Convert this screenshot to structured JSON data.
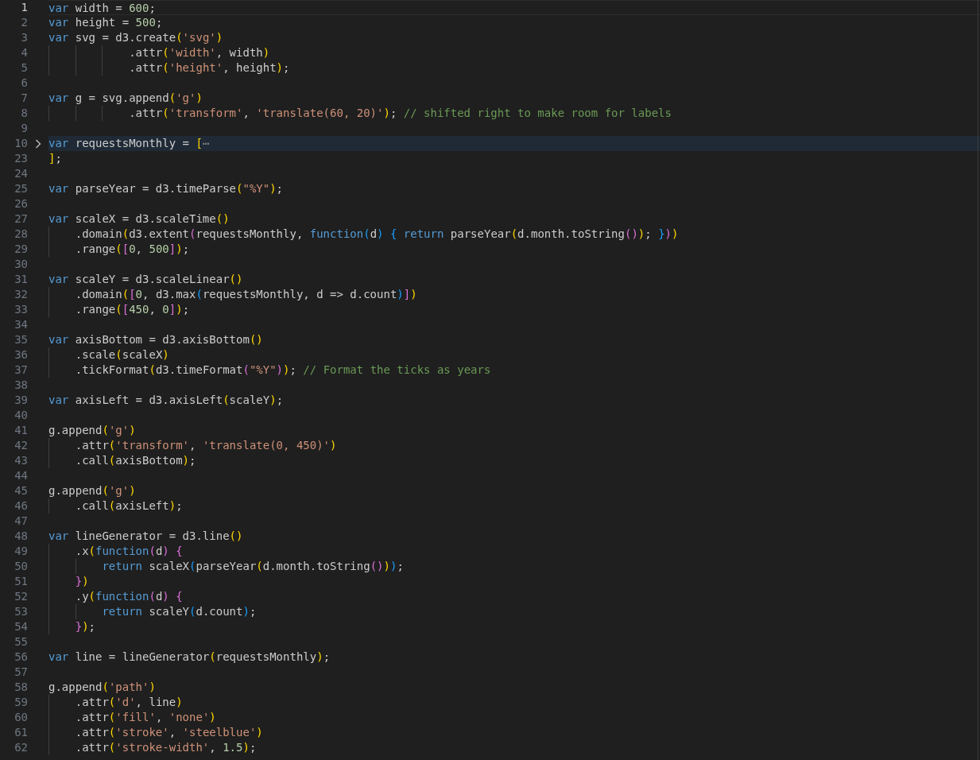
{
  "editor": {
    "lines": [
      {
        "number": "1",
        "active": true,
        "folded": false,
        "highlighted": false,
        "tokens": [
          {
            "kind": "k",
            "text": "var"
          },
          {
            "kind": "t",
            "text": " width = "
          },
          {
            "kind": "n",
            "text": "600"
          },
          {
            "kind": "t",
            "text": ";"
          }
        ]
      },
      {
        "number": "2",
        "active": false,
        "folded": false,
        "highlighted": false,
        "tokens": [
          {
            "kind": "k",
            "text": "var"
          },
          {
            "kind": "t",
            "text": " height = "
          },
          {
            "kind": "n",
            "text": "500"
          },
          {
            "kind": "t",
            "text": ";"
          }
        ]
      },
      {
        "number": "3",
        "active": false,
        "folded": false,
        "highlighted": false,
        "tokens": [
          {
            "kind": "k",
            "text": "var"
          },
          {
            "kind": "t",
            "text": " svg = d3.create"
          },
          {
            "kind": "b1",
            "text": "("
          },
          {
            "kind": "s",
            "text": "'svg'"
          },
          {
            "kind": "b1",
            "text": ")"
          }
        ]
      },
      {
        "number": "4",
        "active": false,
        "folded": false,
        "highlighted": false,
        "tokens": [
          {
            "kind": "t",
            "text": "            .attr"
          },
          {
            "kind": "b1",
            "text": "("
          },
          {
            "kind": "s",
            "text": "'width'"
          },
          {
            "kind": "t",
            "text": ", width"
          },
          {
            "kind": "b1",
            "text": ")"
          }
        ]
      },
      {
        "number": "5",
        "active": false,
        "folded": false,
        "highlighted": false,
        "tokens": [
          {
            "kind": "t",
            "text": "            .attr"
          },
          {
            "kind": "b1",
            "text": "("
          },
          {
            "kind": "s",
            "text": "'height'"
          },
          {
            "kind": "t",
            "text": ", height"
          },
          {
            "kind": "b1",
            "text": ")"
          },
          {
            "kind": "t",
            "text": ";"
          }
        ]
      },
      {
        "number": "6",
        "active": false,
        "folded": false,
        "highlighted": false
      },
      {
        "number": "7",
        "active": false,
        "folded": false,
        "highlighted": false,
        "tokens": [
          {
            "kind": "k",
            "text": "var"
          },
          {
            "kind": "t",
            "text": " g = svg.append"
          },
          {
            "kind": "b1",
            "text": "("
          },
          {
            "kind": "s",
            "text": "'g'"
          },
          {
            "kind": "b1",
            "text": ")"
          }
        ]
      },
      {
        "number": "8",
        "active": false,
        "folded": false,
        "highlighted": false,
        "tokens": [
          {
            "kind": "t",
            "text": "            .attr"
          },
          {
            "kind": "b1",
            "text": "("
          },
          {
            "kind": "s",
            "text": "'transform'"
          },
          {
            "kind": "t",
            "text": ", "
          },
          {
            "kind": "s",
            "text": "'translate(60, 20)'"
          },
          {
            "kind": "b1",
            "text": ")"
          },
          {
            "kind": "t",
            "text": "; "
          },
          {
            "kind": "c",
            "text": "// shifted right to make room for labels"
          }
        ]
      },
      {
        "number": "9",
        "active": false,
        "folded": false,
        "highlighted": false
      },
      {
        "number": "10",
        "active": false,
        "folded": true,
        "highlighted": true,
        "tokens": [
          {
            "kind": "k",
            "text": "var"
          },
          {
            "kind": "t",
            "text": " requestsMonthly = "
          },
          {
            "kind": "b1",
            "text": "["
          },
          {
            "kind": "e",
            "text": "⋯"
          }
        ]
      },
      {
        "number": "23",
        "active": false,
        "folded": false,
        "highlighted": false,
        "tokens": [
          {
            "kind": "b1",
            "text": "]"
          },
          {
            "kind": "t",
            "text": ";"
          }
        ]
      },
      {
        "number": "24",
        "active": false,
        "folded": false,
        "highlighted": false
      },
      {
        "number": "25",
        "active": false,
        "folded": false,
        "highlighted": false,
        "tokens": [
          {
            "kind": "k",
            "text": "var"
          },
          {
            "kind": "t",
            "text": " parseYear = d3.timeParse"
          },
          {
            "kind": "b1",
            "text": "("
          },
          {
            "kind": "s",
            "text": "\"%Y\""
          },
          {
            "kind": "b1",
            "text": ")"
          },
          {
            "kind": "t",
            "text": ";"
          }
        ]
      },
      {
        "number": "26",
        "active": false,
        "folded": false,
        "highlighted": false
      },
      {
        "number": "27",
        "active": false,
        "folded": false,
        "highlighted": false,
        "tokens": [
          {
            "kind": "k",
            "text": "var"
          },
          {
            "kind": "t",
            "text": " scaleX = d3.scaleTime"
          },
          {
            "kind": "b1",
            "text": "("
          },
          {
            "kind": "b1",
            "text": ")"
          }
        ]
      },
      {
        "number": "28",
        "active": false,
        "folded": false,
        "highlighted": false,
        "tokens": [
          {
            "kind": "t",
            "text": "    .domain"
          },
          {
            "kind": "b1",
            "text": "("
          },
          {
            "kind": "t",
            "text": "d3.extent"
          },
          {
            "kind": "b2",
            "text": "("
          },
          {
            "kind": "t",
            "text": "requestsMonthly, "
          },
          {
            "kind": "k",
            "text": "function"
          },
          {
            "kind": "b3",
            "text": "("
          },
          {
            "kind": "t",
            "text": "d"
          },
          {
            "kind": "b3",
            "text": ")"
          },
          {
            "kind": "b3",
            "text": " {"
          },
          {
            "kind": "k",
            "text": " return"
          },
          {
            "kind": "t",
            "text": " parseYear"
          },
          {
            "kind": "b1",
            "text": "("
          },
          {
            "kind": "t",
            "text": "d.month.toString"
          },
          {
            "kind": "b2",
            "text": "("
          },
          {
            "kind": "b2",
            "text": ")"
          },
          {
            "kind": "b1",
            "text": ")"
          },
          {
            "kind": "t",
            "text": "; "
          },
          {
            "kind": "b3",
            "text": "}"
          },
          {
            "kind": "b2",
            "text": ")"
          },
          {
            "kind": "b1",
            "text": ")"
          }
        ]
      },
      {
        "number": "29",
        "active": false,
        "folded": false,
        "highlighted": false,
        "tokens": [
          {
            "kind": "t",
            "text": "    .range"
          },
          {
            "kind": "b1",
            "text": "("
          },
          {
            "kind": "b2",
            "text": "["
          },
          {
            "kind": "n",
            "text": "0"
          },
          {
            "kind": "t",
            "text": ", "
          },
          {
            "kind": "n",
            "text": "500"
          },
          {
            "kind": "b2",
            "text": "]"
          },
          {
            "kind": "b1",
            "text": ")"
          },
          {
            "kind": "t",
            "text": ";"
          }
        ]
      },
      {
        "number": "30",
        "active": false,
        "folded": false,
        "highlighted": false
      },
      {
        "number": "31",
        "active": false,
        "folded": false,
        "highlighted": false,
        "tokens": [
          {
            "kind": "k",
            "text": "var"
          },
          {
            "kind": "t",
            "text": " scaleY = d3.scaleLinear"
          },
          {
            "kind": "b1",
            "text": "("
          },
          {
            "kind": "b1",
            "text": ")"
          }
        ]
      },
      {
        "number": "32",
        "active": false,
        "folded": false,
        "highlighted": false,
        "tokens": [
          {
            "kind": "t",
            "text": "    .domain"
          },
          {
            "kind": "b1",
            "text": "("
          },
          {
            "kind": "b2",
            "text": "["
          },
          {
            "kind": "n",
            "text": "0"
          },
          {
            "kind": "t",
            "text": ", d3.max"
          },
          {
            "kind": "b3",
            "text": "("
          },
          {
            "kind": "t",
            "text": "requestsMonthly, d => d.count"
          },
          {
            "kind": "b3",
            "text": ")"
          },
          {
            "kind": "b2",
            "text": "]"
          },
          {
            "kind": "b1",
            "text": ")"
          }
        ]
      },
      {
        "number": "33",
        "active": false,
        "folded": false,
        "highlighted": false,
        "tokens": [
          {
            "kind": "t",
            "text": "    .range"
          },
          {
            "kind": "b1",
            "text": "("
          },
          {
            "kind": "b2",
            "text": "["
          },
          {
            "kind": "n",
            "text": "450"
          },
          {
            "kind": "t",
            "text": ", "
          },
          {
            "kind": "n",
            "text": "0"
          },
          {
            "kind": "b2",
            "text": "]"
          },
          {
            "kind": "b1",
            "text": ")"
          },
          {
            "kind": "t",
            "text": ";"
          }
        ]
      },
      {
        "number": "34",
        "active": false,
        "folded": false,
        "highlighted": false
      },
      {
        "number": "35",
        "active": false,
        "folded": false,
        "highlighted": false,
        "tokens": [
          {
            "kind": "k",
            "text": "var"
          },
          {
            "kind": "t",
            "text": " axisBottom = d3.axisBottom"
          },
          {
            "kind": "b1",
            "text": "("
          },
          {
            "kind": "b1",
            "text": ")"
          }
        ]
      },
      {
        "number": "36",
        "active": false,
        "folded": false,
        "highlighted": false,
        "tokens": [
          {
            "kind": "t",
            "text": "    .scale"
          },
          {
            "kind": "b1",
            "text": "("
          },
          {
            "kind": "t",
            "text": "scaleX"
          },
          {
            "kind": "b1",
            "text": ")"
          }
        ]
      },
      {
        "number": "37",
        "active": false,
        "folded": false,
        "highlighted": false,
        "tokens": [
          {
            "kind": "t",
            "text": "    .tickFormat"
          },
          {
            "kind": "b1",
            "text": "("
          },
          {
            "kind": "t",
            "text": "d3.timeFormat"
          },
          {
            "kind": "b2",
            "text": "("
          },
          {
            "kind": "s",
            "text": "\"%Y\""
          },
          {
            "kind": "b2",
            "text": ")"
          },
          {
            "kind": "b1",
            "text": ")"
          },
          {
            "kind": "t",
            "text": "; "
          },
          {
            "kind": "c",
            "text": "// Format the ticks as years"
          }
        ]
      },
      {
        "number": "38",
        "active": false,
        "folded": false,
        "highlighted": false
      },
      {
        "number": "39",
        "active": false,
        "folded": false,
        "highlighted": false,
        "tokens": [
          {
            "kind": "k",
            "text": "var"
          },
          {
            "kind": "t",
            "text": " axisLeft = d3.axisLeft"
          },
          {
            "kind": "b1",
            "text": "("
          },
          {
            "kind": "t",
            "text": "scaleY"
          },
          {
            "kind": "b1",
            "text": ")"
          },
          {
            "kind": "t",
            "text": ";"
          }
        ]
      },
      {
        "number": "40",
        "active": false,
        "folded": false,
        "highlighted": false
      },
      {
        "number": "41",
        "active": false,
        "folded": false,
        "highlighted": false,
        "tokens": [
          {
            "kind": "t",
            "text": "g.append"
          },
          {
            "kind": "b1",
            "text": "("
          },
          {
            "kind": "s",
            "text": "'g'"
          },
          {
            "kind": "b1",
            "text": ")"
          }
        ]
      },
      {
        "number": "42",
        "active": false,
        "folded": false,
        "highlighted": false,
        "tokens": [
          {
            "kind": "t",
            "text": "    .attr"
          },
          {
            "kind": "b1",
            "text": "("
          },
          {
            "kind": "s",
            "text": "'transform'"
          },
          {
            "kind": "t",
            "text": ", "
          },
          {
            "kind": "s",
            "text": "'translate(0, 450)'"
          },
          {
            "kind": "b1",
            "text": ")"
          }
        ]
      },
      {
        "number": "43",
        "active": false,
        "folded": false,
        "highlighted": false,
        "tokens": [
          {
            "kind": "t",
            "text": "    .call"
          },
          {
            "kind": "b1",
            "text": "("
          },
          {
            "kind": "t",
            "text": "axisBottom"
          },
          {
            "kind": "b1",
            "text": ")"
          },
          {
            "kind": "t",
            "text": ";"
          }
        ]
      },
      {
        "number": "44",
        "active": false,
        "folded": false,
        "highlighted": false
      },
      {
        "number": "45",
        "active": false,
        "folded": false,
        "highlighted": false,
        "tokens": [
          {
            "kind": "t",
            "text": "g.append"
          },
          {
            "kind": "b1",
            "text": "("
          },
          {
            "kind": "s",
            "text": "'g'"
          },
          {
            "kind": "b1",
            "text": ")"
          }
        ]
      },
      {
        "number": "46",
        "active": false,
        "folded": false,
        "highlighted": false,
        "tokens": [
          {
            "kind": "t",
            "text": "    .call"
          },
          {
            "kind": "b1",
            "text": "("
          },
          {
            "kind": "t",
            "text": "axisLeft"
          },
          {
            "kind": "b1",
            "text": ")"
          },
          {
            "kind": "t",
            "text": ";"
          }
        ]
      },
      {
        "number": "47",
        "active": false,
        "folded": false,
        "highlighted": false
      },
      {
        "number": "48",
        "active": false,
        "folded": false,
        "highlighted": false,
        "tokens": [
          {
            "kind": "k",
            "text": "var"
          },
          {
            "kind": "t",
            "text": " lineGenerator = d3.line"
          },
          {
            "kind": "b1",
            "text": "("
          },
          {
            "kind": "b1",
            "text": ")"
          }
        ]
      },
      {
        "number": "49",
        "active": false,
        "folded": false,
        "highlighted": false,
        "tokens": [
          {
            "kind": "t",
            "text": "    .x"
          },
          {
            "kind": "b1",
            "text": "("
          },
          {
            "kind": "k",
            "text": "function"
          },
          {
            "kind": "b2",
            "text": "("
          },
          {
            "kind": "t",
            "text": "d"
          },
          {
            "kind": "b2",
            "text": ")"
          },
          {
            "kind": "b2",
            "text": " {"
          }
        ]
      },
      {
        "number": "50",
        "active": false,
        "folded": false,
        "highlighted": false,
        "tokens": [
          {
            "kind": "k",
            "text": "        return"
          },
          {
            "kind": "t",
            "text": " scaleX"
          },
          {
            "kind": "b3",
            "text": "("
          },
          {
            "kind": "t",
            "text": "parseYear"
          },
          {
            "kind": "b1",
            "text": "("
          },
          {
            "kind": "t",
            "text": "d.month.toString"
          },
          {
            "kind": "b2",
            "text": "("
          },
          {
            "kind": "b2",
            "text": ")"
          },
          {
            "kind": "b1",
            "text": ")"
          },
          {
            "kind": "b3",
            "text": ")"
          },
          {
            "kind": "t",
            "text": ";"
          }
        ]
      },
      {
        "number": "51",
        "active": false,
        "folded": false,
        "highlighted": false,
        "tokens": [
          {
            "kind": "b2",
            "text": "    }"
          },
          {
            "kind": "b1",
            "text": ")"
          }
        ]
      },
      {
        "number": "52",
        "active": false,
        "folded": false,
        "highlighted": false,
        "tokens": [
          {
            "kind": "t",
            "text": "    .y"
          },
          {
            "kind": "b1",
            "text": "("
          },
          {
            "kind": "k",
            "text": "function"
          },
          {
            "kind": "b2",
            "text": "("
          },
          {
            "kind": "t",
            "text": "d"
          },
          {
            "kind": "b2",
            "text": ")"
          },
          {
            "kind": "b2",
            "text": " {"
          }
        ]
      },
      {
        "number": "53",
        "active": false,
        "folded": false,
        "highlighted": false,
        "tokens": [
          {
            "kind": "k",
            "text": "        return"
          },
          {
            "kind": "t",
            "text": " scaleY"
          },
          {
            "kind": "b3",
            "text": "("
          },
          {
            "kind": "t",
            "text": "d.count"
          },
          {
            "kind": "b3",
            "text": ")"
          },
          {
            "kind": "t",
            "text": ";"
          }
        ]
      },
      {
        "number": "54",
        "active": false,
        "folded": false,
        "highlighted": false,
        "tokens": [
          {
            "kind": "b2",
            "text": "    }"
          },
          {
            "kind": "b1",
            "text": ")"
          },
          {
            "kind": "t",
            "text": ";"
          }
        ]
      },
      {
        "number": "55",
        "active": false,
        "folded": false,
        "highlighted": false
      },
      {
        "number": "56",
        "active": false,
        "folded": false,
        "highlighted": false,
        "tokens": [
          {
            "kind": "k",
            "text": "var"
          },
          {
            "kind": "t",
            "text": " line = lineGenerator"
          },
          {
            "kind": "b1",
            "text": "("
          },
          {
            "kind": "t",
            "text": "requestsMonthly"
          },
          {
            "kind": "b1",
            "text": ")"
          },
          {
            "kind": "t",
            "text": ";"
          }
        ]
      },
      {
        "number": "57",
        "active": false,
        "folded": false,
        "highlighted": false
      },
      {
        "number": "58",
        "active": false,
        "folded": false,
        "highlighted": false,
        "tokens": [
          {
            "kind": "t",
            "text": "g.append"
          },
          {
            "kind": "b1",
            "text": "("
          },
          {
            "kind": "s",
            "text": "'path'"
          },
          {
            "kind": "b1",
            "text": ")"
          }
        ]
      },
      {
        "number": "59",
        "active": false,
        "folded": false,
        "highlighted": false,
        "tokens": [
          {
            "kind": "t",
            "text": "    .attr"
          },
          {
            "kind": "b1",
            "text": "("
          },
          {
            "kind": "s",
            "text": "'d'"
          },
          {
            "kind": "t",
            "text": ", line"
          },
          {
            "kind": "b1",
            "text": ")"
          }
        ]
      },
      {
        "number": "60",
        "active": false,
        "folded": false,
        "highlighted": false,
        "tokens": [
          {
            "kind": "t",
            "text": "    .attr"
          },
          {
            "kind": "b1",
            "text": "("
          },
          {
            "kind": "s",
            "text": "'fill'"
          },
          {
            "kind": "t",
            "text": ", "
          },
          {
            "kind": "s",
            "text": "'none'"
          },
          {
            "kind": "b1",
            "text": ")"
          }
        ]
      },
      {
        "number": "61",
        "active": false,
        "folded": false,
        "highlighted": false,
        "tokens": [
          {
            "kind": "t",
            "text": "    .attr"
          },
          {
            "kind": "b1",
            "text": "("
          },
          {
            "kind": "s",
            "text": "'stroke'"
          },
          {
            "kind": "t",
            "text": ", "
          },
          {
            "kind": "s",
            "text": "'steelblue'"
          },
          {
            "kind": "b1",
            "text": ")"
          }
        ]
      },
      {
        "number": "62",
        "active": false,
        "folded": false,
        "highlighted": false,
        "tokens": [
          {
            "kind": "t",
            "text": "    .attr"
          },
          {
            "kind": "b1",
            "text": "("
          },
          {
            "kind": "s",
            "text": "'stroke-width'"
          },
          {
            "kind": "t",
            "text": ", "
          },
          {
            "kind": "n",
            "text": "1.5"
          },
          {
            "kind": "b1",
            "text": ")"
          },
          {
            "kind": "t",
            "text": ";"
          }
        ]
      }
    ]
  }
}
